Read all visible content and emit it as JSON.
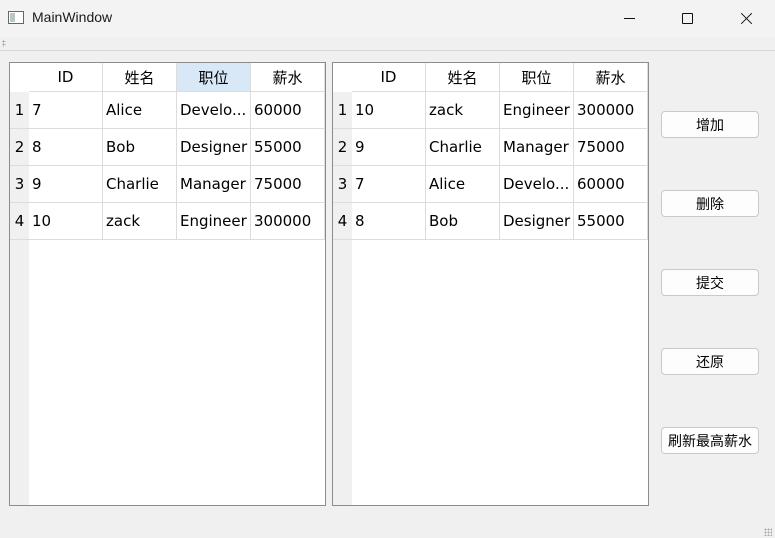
{
  "window": {
    "title": "MainWindow"
  },
  "table_left": {
    "columns": [
      "ID",
      "姓名",
      "职位",
      "薪水"
    ],
    "selected_column": "职位",
    "row_numbers": [
      "1",
      "2",
      "3",
      "4"
    ],
    "rows": [
      [
        "7",
        "Alice",
        "Develo...",
        "60000"
      ],
      [
        "8",
        "Bob",
        "Designer",
        "55000"
      ],
      [
        "9",
        "Charlie",
        "Manager",
        "75000"
      ],
      [
        "10",
        "zack",
        "Engineer",
        "300000"
      ]
    ]
  },
  "table_right": {
    "columns": [
      "ID",
      "姓名",
      "职位",
      "薪水"
    ],
    "row_numbers": [
      "1",
      "2",
      "3",
      "4"
    ],
    "rows": [
      [
        "10",
        "zack",
        "Engineer",
        "300000"
      ],
      [
        "9",
        "Charlie",
        "Manager",
        "75000"
      ],
      [
        "7",
        "Alice",
        "Develo...",
        "60000"
      ],
      [
        "8",
        "Bob",
        "Designer",
        "55000"
      ]
    ]
  },
  "buttons": {
    "add": "增加",
    "delete": "删除",
    "submit": "提交",
    "revert": "还原",
    "refresh_max_salary": "刷新最高薪水"
  },
  "colors": {
    "selected_header": "#d8e8f7",
    "row_header_bg": "#f0f0f0",
    "window_bg": "#f0f0f0"
  },
  "icons": [
    "app-window-icon",
    "minimize-icon",
    "maximize-icon",
    "close-icon",
    "toolbar-handle-icon",
    "resize-grip-icon"
  ]
}
